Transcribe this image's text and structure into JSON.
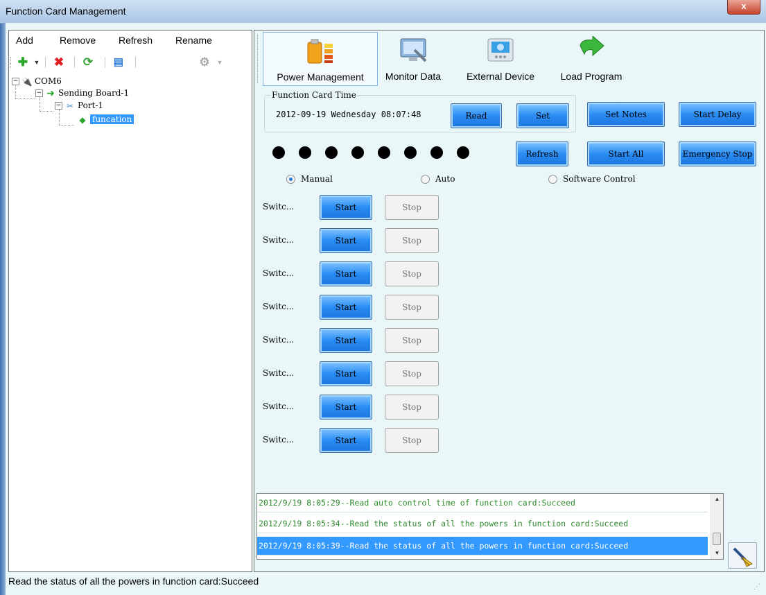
{
  "window": {
    "title": "Function Card Management",
    "close_label": "x"
  },
  "left": {
    "menu": [
      "Add",
      "Remove",
      "Refresh",
      "Rename"
    ],
    "tree": {
      "com": "COM6",
      "sending_board": "Sending Board-1",
      "port": "Port-1",
      "function_card": "funcation"
    }
  },
  "tabs": [
    {
      "label": "Power Management",
      "icon": "battery-icon"
    },
    {
      "label": "Monitor Data",
      "icon": "monitor-icon"
    },
    {
      "label": "External Device",
      "icon": "device-icon"
    },
    {
      "label": "Load Program",
      "icon": "green-arrow-icon"
    }
  ],
  "power": {
    "group_title": "Function Card Time",
    "datetime": "2012-09-19 Wednesday 08:07:48",
    "buttons": {
      "read": "Read",
      "set": "Set",
      "set_notes": "Set Notes",
      "start_delay": "Start Delay",
      "refresh": "Refresh",
      "start_all": "Start All",
      "emergency_stop": "Emergency Stop"
    },
    "modes": {
      "manual": "Manual",
      "auto": "Auto",
      "software": "Software Control",
      "selected": "Manual"
    },
    "switches": [
      {
        "label": "Switc...",
        "start": "Start",
        "stop": "Stop"
      },
      {
        "label": "Switc...",
        "start": "Start",
        "stop": "Stop"
      },
      {
        "label": "Switc...",
        "start": "Start",
        "stop": "Stop"
      },
      {
        "label": "Switc...",
        "start": "Start",
        "stop": "Stop"
      },
      {
        "label": "Switc...",
        "start": "Start",
        "stop": "Stop"
      },
      {
        "label": "Switc...",
        "start": "Start",
        "stop": "Stop"
      },
      {
        "label": "Switc...",
        "start": "Start",
        "stop": "Stop"
      },
      {
        "label": "Switc...",
        "start": "Start",
        "stop": "Stop"
      }
    ]
  },
  "log": [
    "2012/9/19 8:05:29--Read auto control time of function card:Succeed",
    "2012/9/19 8:05:34--Read the status of all the powers in function card:Succeed",
    "2012/9/19 8:05:39--Read the status of all the powers in function card:Succeed"
  ],
  "status": "Read the status of all the powers in function card:Succeed",
  "colors": {
    "button_blue": "#2a8cf4",
    "selection": "#3399ff",
    "log_text": "#2e8b2e",
    "background": "#eaf7f8"
  }
}
